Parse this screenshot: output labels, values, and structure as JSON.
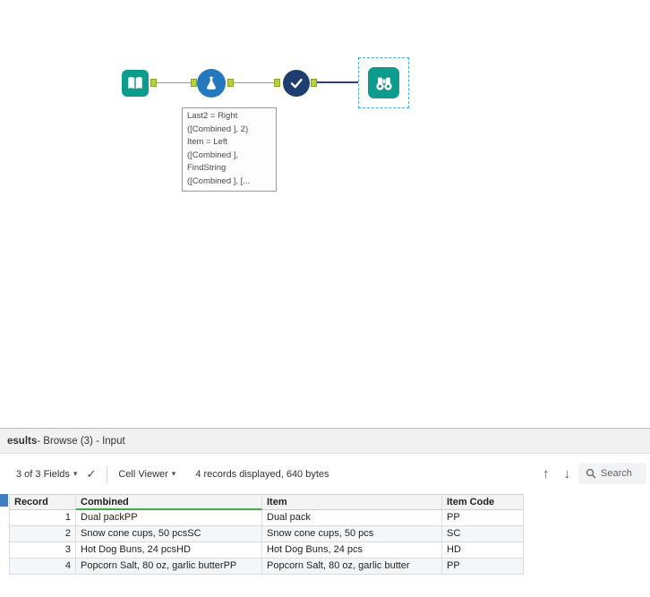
{
  "icons": {
    "chevron_down": "▾",
    "check": "✓",
    "arrow_up": "↑",
    "arrow_down": "↓"
  },
  "canvas": {
    "tools": [
      {
        "type": "input-data"
      },
      {
        "type": "formula"
      },
      {
        "type": "select"
      },
      {
        "type": "browse",
        "selected": true
      }
    ],
    "annotation_lines": [
      "Last2 = Right",
      "([Combined ], 2)",
      "Item = Left",
      "([Combined ],",
      "FindString",
      "([Combined ], [..."
    ]
  },
  "results": {
    "header": {
      "title_bold": "esults",
      "title_rest": " - Browse (3) - Input"
    },
    "toolbar": {
      "fields_label": "3 of 3 Fields",
      "cell_viewer_label": "Cell Viewer",
      "records_label": "4 records displayed, 640 bytes",
      "search_label": "Search"
    },
    "table": {
      "columns": [
        "Record",
        "Combined",
        "Item",
        "Item Code"
      ],
      "rows": [
        [
          "1",
          "Dual packPP",
          "Dual pack",
          "PP"
        ],
        [
          "2",
          "Snow cone cups, 50 pcsSC",
          "Snow cone cups, 50 pcs",
          "SC"
        ],
        [
          "3",
          "Hot Dog Buns, 24 pcsHD",
          "Hot Dog Buns, 24 pcs",
          "HD"
        ],
        [
          "4",
          "Popcorn Salt, 80 oz, garlic butterPP",
          "Popcorn Salt, 80 oz, garlic butter",
          "PP"
        ]
      ]
    }
  },
  "colors": {
    "teal": "#0c9b8d",
    "formula_blue": "#2478bd",
    "select_navy": "#1d3e6f",
    "anchor_green": "#b5d334",
    "selection_blue": "#45a9df",
    "wire_selected": "#27418f",
    "header_underline_green": "#3fae49"
  }
}
